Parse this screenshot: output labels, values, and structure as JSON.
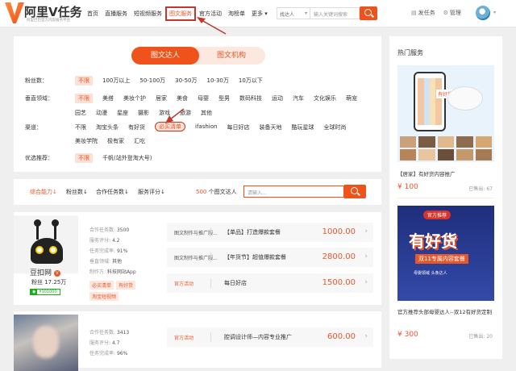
{
  "header": {
    "logo_text": "阿里V任务",
    "logo_sub": "阿里巴巴官方内容服务平台",
    "nav": [
      "首页",
      "直播服务",
      "短视频服务",
      "图文服务",
      "官方活动",
      "淘榜单",
      "更多"
    ],
    "active_nav": "图文服务",
    "search_select": "找达人",
    "search_placeholder": "输入关键词搜索",
    "publish": "发任务",
    "manage": "管理"
  },
  "filters": {
    "tabs": [
      "图文达人",
      "图文机构"
    ],
    "rows": [
      {
        "label": "粉丝数：",
        "options": [
          "不限",
          "100万以上",
          "50-100万",
          "30-50万",
          "10-30万",
          "10万以下"
        ]
      },
      {
        "label": "垂直领域：",
        "options": [
          "不限",
          "美搭",
          "美妆个护",
          "居家",
          "美食",
          "母婴",
          "型男",
          "数码科技",
          "运动",
          "汽车",
          "文化娱乐",
          "萌宠",
          "园艺",
          "动漫",
          "星座",
          "摄影",
          "游戏",
          "旅游",
          "其他"
        ]
      },
      {
        "label": "渠道：",
        "options": [
          "不限",
          "淘宝头条",
          "有好货",
          "必买清单",
          "ifashion",
          "每日好店",
          "装备天地",
          "酷玩星球",
          "全球时尚",
          "美妆学院",
          "极有家",
          "汇吃"
        ]
      },
      {
        "label": "优选推荐：",
        "options": [
          "不限",
          "千帆(站外登淘大号)"
        ]
      }
    ]
  },
  "sortbar": {
    "items": [
      "综合能力↓",
      "粉丝数↓",
      "合作任务数↓",
      "服务评分↓"
    ],
    "count_num": "500",
    "count_text": "个图文达人",
    "search_placeholder": "请输入..."
  },
  "cards": [
    {
      "name": "豆扣网",
      "fans": "粉丝 17.25万",
      "price": "¥101000",
      "stats": [
        {
          "k": "合作任务数",
          "v": "3500"
        },
        {
          "k": "服务评分",
          "v": "4.2"
        },
        {
          "k": "任务完成率",
          "v": "91%"
        },
        {
          "k": "垂直领域",
          "v": "其他"
        },
        {
          "k": "制作方",
          "v": "科技网站App"
        }
      ],
      "tags": [
        "必买清单",
        "有好货",
        "淘宝短视频"
      ],
      "services": [
        {
          "type": "图文制作与推广服...",
          "name": "【单品】打造爆款套餐",
          "price": "1000.00"
        },
        {
          "type": "图文制作与推广服...",
          "name": "【年货节】超值爆款套餐",
          "price": "2800.00"
        },
        {
          "type": "官方活动",
          "name": "每日好店",
          "price": "1500.00"
        }
      ]
    },
    {
      "stats": [
        {
          "k": "合作任务数",
          "v": "3413"
        },
        {
          "k": "服务评分",
          "v": "4.7"
        },
        {
          "k": "任务完成率",
          "v": "96%"
        }
      ],
      "services": [
        {
          "type": "官方活动",
          "name": "腔调设计师—内容专业推广",
          "price": "600.00"
        }
      ]
    }
  ],
  "sidebar": {
    "title": "热门服务",
    "items": [
      {
        "caption": "【居家】有好货内容推广",
        "price": "¥ 100",
        "sold": "已售出: 67",
        "img_badge": "有好货"
      },
      {
        "caption": "官方推荐头部母婴达人--双12有好货定制",
        "price": "¥ 300",
        "sold": "已售出: 20",
        "banner_top": "官方推荐",
        "banner_big": "有好货",
        "banner_sub": "双11专属内容套餐",
        "banner_foot": "母婴领域 头条达人"
      }
    ]
  },
  "colors": {
    "accent": "#f0521b",
    "annotation": "#c0392b"
  }
}
